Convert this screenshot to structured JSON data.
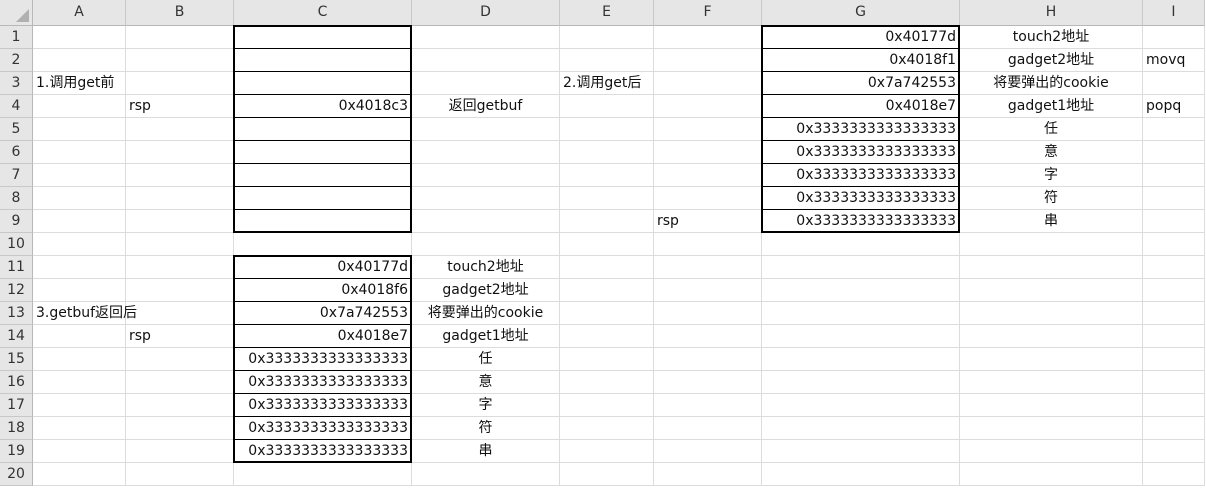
{
  "columns": [
    "A",
    "B",
    "C",
    "D",
    "E",
    "F",
    "G",
    "H",
    "I"
  ],
  "rows": [
    "1",
    "2",
    "3",
    "4",
    "5",
    "6",
    "7",
    "8",
    "9",
    "10",
    "11",
    "12",
    "13",
    "14",
    "15",
    "16",
    "17",
    "18",
    "19",
    "20"
  ],
  "cells": {
    "G1": "0x40177d",
    "H1": "touch2地址",
    "G2": "0x4018f1",
    "H2": "gadget2地址",
    "I2": "movq",
    "A3": "1.调用get前",
    "E3": "2.调用get后",
    "G3": "0x7a742553",
    "H3": "将要弹出的cookie",
    "B4": "rsp",
    "C4": "0x4018c3",
    "D4": "返回getbuf",
    "G4": "0x4018e7",
    "H4": "gadget1地址",
    "I4": "popq",
    "G5": "0x3333333333333333",
    "H5": "任",
    "G6": "0x3333333333333333",
    "H6": "意",
    "G7": "0x3333333333333333",
    "H7": "字",
    "G8": "0x3333333333333333",
    "H8": "符",
    "F9": "rsp",
    "G9": "0x3333333333333333",
    "H9": "串",
    "C11": "0x40177d",
    "D11": "touch2地址",
    "C12": "0x4018f6",
    "D12": "gadget2地址",
    "A13": "3.getbuf返回后",
    "C13": "0x7a742553",
    "D13": "将要弹出的cookie",
    "B14": "rsp",
    "C14": "0x4018e7",
    "D14": "gadget1地址",
    "C15": "0x3333333333333333",
    "D15": "任",
    "C16": "0x3333333333333333",
    "D16": "意",
    "C17": "0x3333333333333333",
    "D17": "字",
    "C18": "0x3333333333333333",
    "D18": "符",
    "C19": "0x3333333333333333",
    "D19": "串"
  }
}
